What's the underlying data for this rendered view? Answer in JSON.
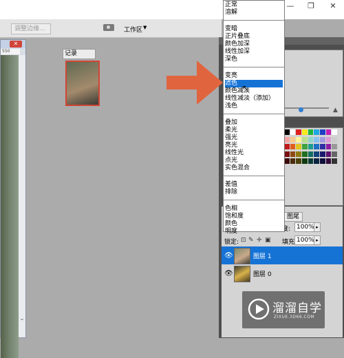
{
  "window": {
    "minimize_glyph": "—",
    "restore_glyph": "❐",
    "close_glyph": "✕"
  },
  "options_bar": {
    "refine_edge_label": "调整边缘...",
    "workspace_label": "工作区",
    "workspace_arrow": "▼"
  },
  "document": {
    "ruler_value": "550",
    "close_glyph": "✕",
    "scroll_down_glyph": "⌄"
  },
  "history": {
    "tab_label": "记录"
  },
  "layers": {
    "tab_label": "图尾",
    "opacity_label": "度:",
    "opacity_value": "100%",
    "lock_label": "锁定:",
    "fill_label": "填充:",
    "fill_value": "100%",
    "items": [
      {
        "name": "图层 1",
        "selected": true
      },
      {
        "name": "图层 0",
        "selected": false
      }
    ]
  },
  "blend_menu": {
    "groups": [
      [
        "正常",
        "溶解"
      ],
      [
        "变暗",
        "正片叠底",
        "颜色加深",
        "线性加深",
        "深色"
      ],
      [
        "变亮",
        "滤色",
        "颜色减淡",
        "线性减淡（添加）",
        "浅色"
      ],
      [
        "叠加",
        "柔光",
        "强光",
        "亮光",
        "线性光",
        "点光",
        "实色混合"
      ],
      [
        "差值",
        "排除"
      ],
      [
        "色相",
        "饱和度",
        "颜色",
        "明度"
      ]
    ],
    "selected": "滤色"
  },
  "watermark": {
    "brand": "溜溜自学",
    "url": "ZIXUE.3D66.COM"
  },
  "colors": {
    "accent": "#1673d6",
    "annotation_arrow": "#e0653f",
    "canvas_bg": "#ababab"
  },
  "swatch_colors": [
    "#000000",
    "#ffffff",
    "#e02020",
    "#f7e91c",
    "#1fb53a",
    "#1ea8e0",
    "#1d3fc4",
    "#c21fb5",
    "#ffffff",
    "#f4a3a3",
    "#f7c98d",
    "#fff39a",
    "#b9e08a",
    "#8fd6c8",
    "#89c2ef",
    "#a39ae0",
    "#e09ad6",
    "#cccccc",
    "#c21a1a",
    "#e05d1f",
    "#e0c51f",
    "#3fa33f",
    "#1f9e8e",
    "#1f6fc4",
    "#2f2fa3",
    "#8e1fa3",
    "#999999",
    "#7a1010",
    "#8e4a12",
    "#8e7a12",
    "#1f6e1f",
    "#126e62",
    "#12427a",
    "#1a1a6e",
    "#5e126e",
    "#666666",
    "#3a0a0a",
    "#4a2a0a",
    "#4a400a",
    "#0e3a0e",
    "#0a3a34",
    "#0a2340",
    "#0e0e3a",
    "#320a3a",
    "#333333"
  ]
}
